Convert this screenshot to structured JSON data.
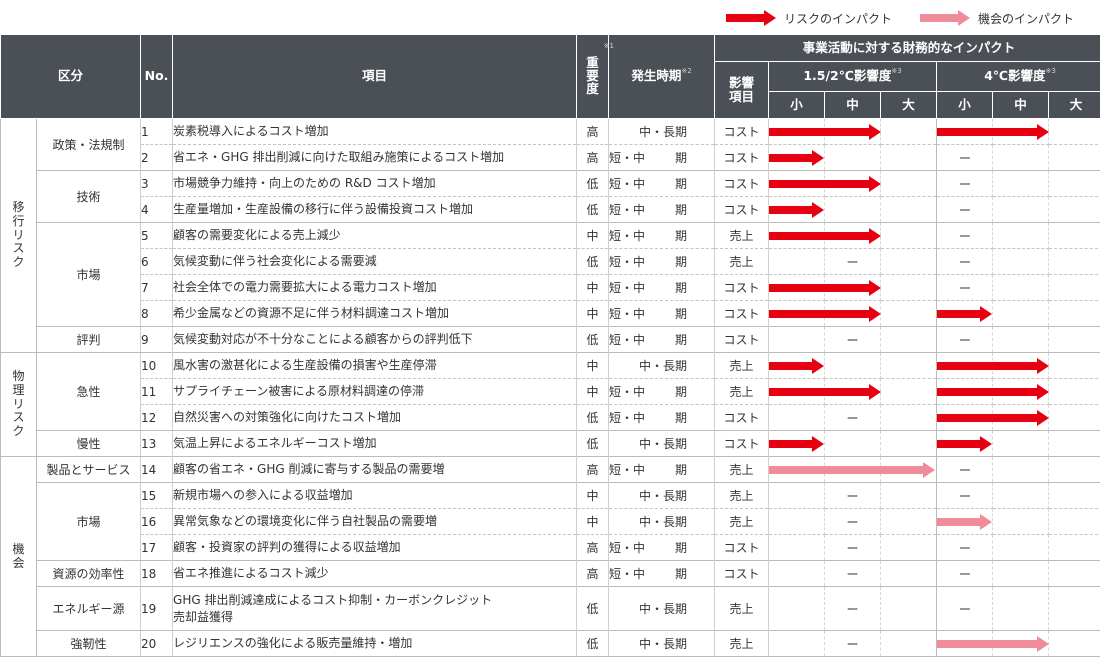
{
  "legend": {
    "risk_label": "リスクのインパクト",
    "opportunity_label": "機会のインパクト"
  },
  "colors": {
    "risk": "#e60012",
    "opportunity": "#f08c9a",
    "header_bg": "#4a5055"
  },
  "header": {
    "category": "区分",
    "no": "No.",
    "item": "項目",
    "importance": "重要度",
    "importance_note": "※1",
    "timing": "発生時期",
    "timing_note": "※2",
    "financial_impact": "事業活動に対する財務的なインパクト",
    "affected_line1": "影響",
    "affected_line2": "項目",
    "scenario_15": "1.5/2℃影響度",
    "scenario_15_note": "※3",
    "scenario_4": "4℃影響度",
    "scenario_4_note": "※3",
    "small": "小",
    "medium": "中",
    "large": "大"
  },
  "groups": {
    "transition": "移行リスク",
    "physical": "物理リスク",
    "opportunity": "機会"
  },
  "subcats": {
    "policy": "政策・法規制",
    "technology": "技術",
    "market": "市場",
    "reputation": "評判",
    "acute": "急性",
    "chronic": "慢性",
    "products": "製品とサービス",
    "market2": "市場",
    "efficiency": "資源の効率性",
    "energy": "エネルギー源",
    "resilience": "強靭性"
  },
  "dash": "ー",
  "rows": [
    {
      "no": "1",
      "item": "炭素税導入によるコスト増加",
      "imp": "高",
      "t1": "中・長期",
      "t2": "",
      "affect": "コスト",
      "a15": 2,
      "a4": 2,
      "kind": "risk"
    },
    {
      "no": "2",
      "item": "省エネ・GHG 排出削減に向けた取組み施策によるコスト増加",
      "imp": "高",
      "t1": "短・中",
      "t2": "期",
      "affect": "コスト",
      "a15": 1,
      "a4": 0,
      "kind": "risk"
    },
    {
      "no": "3",
      "item": "市場競争力維持・向上のための R&D コスト増加",
      "imp": "低",
      "t1": "短・中",
      "t2": "期",
      "affect": "コスト",
      "a15": 2,
      "a4": 0,
      "kind": "risk"
    },
    {
      "no": "4",
      "item": "生産量増加・生産設備の移行に伴う設備投資コスト増加",
      "imp": "低",
      "t1": "短・中",
      "t2": "期",
      "affect": "コスト",
      "a15": 1,
      "a4": 0,
      "kind": "risk"
    },
    {
      "no": "5",
      "item": "顧客の需要変化による売上減少",
      "imp": "中",
      "t1": "短・中",
      "t2": "期",
      "affect": "売上",
      "a15": 2,
      "a4": 0,
      "kind": "risk"
    },
    {
      "no": "6",
      "item": "気候変動に伴う社会変化による需要減",
      "imp": "低",
      "t1": "短・中",
      "t2": "期",
      "affect": "売上",
      "a15": 0,
      "a4": 0,
      "kind": "risk"
    },
    {
      "no": "7",
      "item": "社会全体での電力需要拡大による電力コスト増加",
      "imp": "中",
      "t1": "短・中",
      "t2": "期",
      "affect": "コスト",
      "a15": 2,
      "a4": 0,
      "kind": "risk"
    },
    {
      "no": "8",
      "item": "希少金属などの資源不足に伴う材料調達コスト増加",
      "imp": "中",
      "t1": "短・中",
      "t2": "期",
      "affect": "コスト",
      "a15": 2,
      "a4": 1,
      "kind": "risk"
    },
    {
      "no": "9",
      "item": "気候変動対応が不十分なことによる顧客からの評判低下",
      "imp": "低",
      "t1": "短・中",
      "t2": "期",
      "affect": "コスト",
      "a15": 0,
      "a4": 0,
      "kind": "risk"
    },
    {
      "no": "10",
      "item": "風水害の激甚化による生産設備の損害や生産停滞",
      "imp": "中",
      "t1": "中・長期",
      "t2": "",
      "affect": "売上",
      "a15": 1,
      "a4": 2,
      "kind": "risk"
    },
    {
      "no": "11",
      "item": "サプライチェーン被害による原材料調達の停滞",
      "imp": "中",
      "t1": "短・中",
      "t2": "期",
      "affect": "売上",
      "a15": 2,
      "a4": 2,
      "kind": "risk"
    },
    {
      "no": "12",
      "item": "自然災害への対策強化に向けたコスト増加",
      "imp": "低",
      "t1": "短・中",
      "t2": "期",
      "affect": "コスト",
      "a15": 0,
      "a4": 2,
      "kind": "risk"
    },
    {
      "no": "13",
      "item": "気温上昇によるエネルギーコスト増加",
      "imp": "低",
      "t1": "中・長期",
      "t2": "",
      "affect": "コスト",
      "a15": 1,
      "a4": 1,
      "kind": "risk"
    },
    {
      "no": "14",
      "item": "顧客の省エネ・GHG 削減に寄与する製品の需要増",
      "imp": "高",
      "t1": "短・中",
      "t2": "期",
      "affect": "売上",
      "a15": 3,
      "a4": 0,
      "kind": "opp"
    },
    {
      "no": "15",
      "item": "新規市場への参入による収益増加",
      "imp": "中",
      "t1": "中・長期",
      "t2": "",
      "affect": "売上",
      "a15": 0,
      "a4": 0,
      "kind": "opp"
    },
    {
      "no": "16",
      "item": "異常気象などの環境変化に伴う自社製品の需要増",
      "imp": "中",
      "t1": "中・長期",
      "t2": "",
      "affect": "売上",
      "a15": 0,
      "a4": 1,
      "kind": "opp"
    },
    {
      "no": "17",
      "item": "顧客・投資家の評判の獲得による収益増加",
      "imp": "高",
      "t1": "短・中",
      "t2": "期",
      "affect": "コスト",
      "a15": 0,
      "a4": 0,
      "kind": "opp"
    },
    {
      "no": "18",
      "item": "省エネ推進によるコスト減少",
      "imp": "高",
      "t1": "短・中",
      "t2": "期",
      "affect": "コスト",
      "a15": 0,
      "a4": 0,
      "kind": "opp"
    },
    {
      "no": "19",
      "item": "GHG 排出削減達成によるコスト抑制・カーボンクレジット\n売却益獲得",
      "imp": "低",
      "t1": "中・長期",
      "t2": "",
      "affect": "売上",
      "a15": 0,
      "a4": 0,
      "kind": "opp"
    },
    {
      "no": "20",
      "item": "レジリエンスの強化による販売量維持・増加",
      "imp": "低",
      "t1": "中・長期",
      "t2": "",
      "affect": "売上",
      "a15": 0,
      "a4": 2,
      "kind": "opp"
    }
  ]
}
